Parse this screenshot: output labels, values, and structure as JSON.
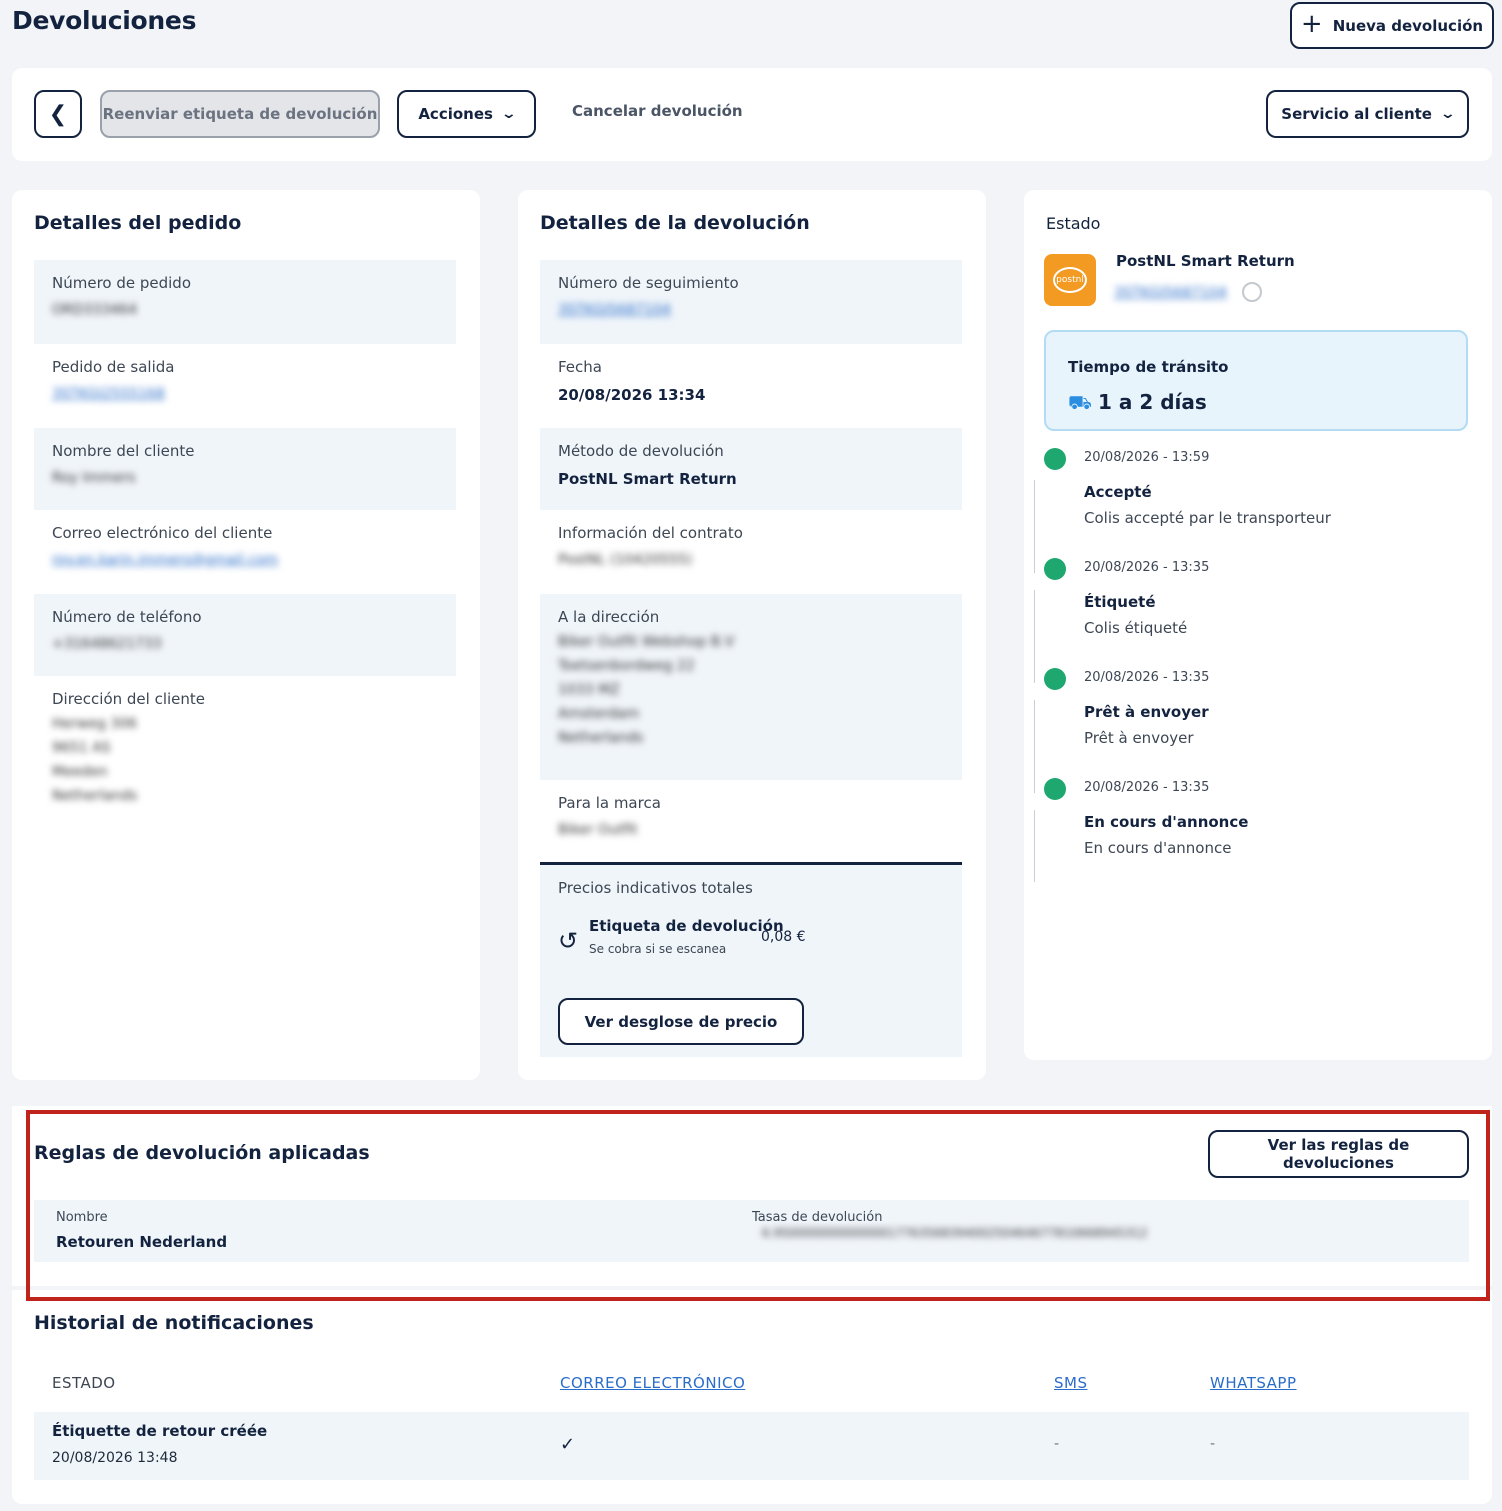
{
  "page": {
    "title": "Devoluciones",
    "new_return_label": "Nueva devolución"
  },
  "toolbar": {
    "resend_label": "Reenviar etiqueta de devolución",
    "actions_label": "Acciones",
    "cancel_label": "Cancelar devolución",
    "service_label": "Servicio al cliente"
  },
  "order": {
    "title": "Detalles del pedido",
    "fields": [
      {
        "label": "Número de pedido",
        "value": "ORD333464"
      },
      {
        "label": "Pedido de salida",
        "value": "3STKGJ2555168"
      },
      {
        "label": "Nombre del cliente",
        "value": "Roy Immers"
      },
      {
        "label": "Correo electrónico del cliente",
        "value": "roy.en.karin.immers@gmail.com"
      },
      {
        "label": "Número de teléfono",
        "value": "+31648621733"
      },
      {
        "label": "Dirección del cliente",
        "lines": [
          "Herweg 306",
          "9651 AS",
          "Meeden",
          "Netherlands"
        ]
      }
    ]
  },
  "return": {
    "title": "Detalles de la devolución",
    "fields": [
      {
        "label": "Número de seguimiento",
        "value": "3STKGJ5687104"
      },
      {
        "label": "Fecha",
        "value": "20/08/2026 13:34"
      },
      {
        "label": "Método de devolución",
        "value": "PostNL Smart Return"
      },
      {
        "label": "Información del contrato",
        "value": "PostNL (10420555)"
      },
      {
        "label": "A la dirección",
        "lines": [
          "Biker Outfit Webshop B.V",
          "Toetsenbordweg 22",
          "1033 MZ",
          "Amsterdam",
          "Netherlands"
        ]
      },
      {
        "label": "Para la marca",
        "value": "Biker Outfit"
      }
    ],
    "prices": {
      "title": "Precios indicativos totales",
      "item_label": "Etiqueta de devolución",
      "item_note": "Se cobra si se escanea",
      "item_amount": "0,08 €",
      "breakdown_label": "Ver desglose de precio"
    }
  },
  "status": {
    "title": "Estado",
    "carrier_name": "PostNL Smart Return",
    "carrier_logo_text": "postnl",
    "tracking": "3STKGJ5687104",
    "transit_label": "Tiempo de tránsito",
    "transit_value": "1 a 2 días",
    "events": [
      {
        "time": "20/08/2026 - 13:59",
        "title": "Accepté",
        "desc": "Colis accepté par le transporteur"
      },
      {
        "time": "20/08/2026 - 13:35",
        "title": "Étiqueté",
        "desc": "Colis étiqueté"
      },
      {
        "time": "20/08/2026 - 13:35",
        "title": "Prêt à envoyer",
        "desc": "Prêt à envoyer"
      },
      {
        "time": "20/08/2026 - 13:35",
        "title": "En cours d'annonce",
        "desc": "En cours d'annonce"
      }
    ]
  },
  "rules": {
    "title": "Reglas de devolución aplicadas",
    "view_label": "Ver las reglas de devoluciones",
    "name_label": "Nombre",
    "name_value": "Retouren Nederland",
    "fees_label": "Tasas de devolución",
    "fees_value": "6.9500000000000001776356839400250464677810668945312"
  },
  "history": {
    "title": "Historial de notificaciones",
    "columns": [
      "ESTADO",
      "CORREO ELECTRÓNICO",
      "SMS",
      "WHATSAPP"
    ],
    "rows": [
      {
        "status": "Étiquette de retour créée",
        "date": "20/08/2026 13:48",
        "email": "✓",
        "sms": "-",
        "whatsapp": "-"
      }
    ]
  }
}
